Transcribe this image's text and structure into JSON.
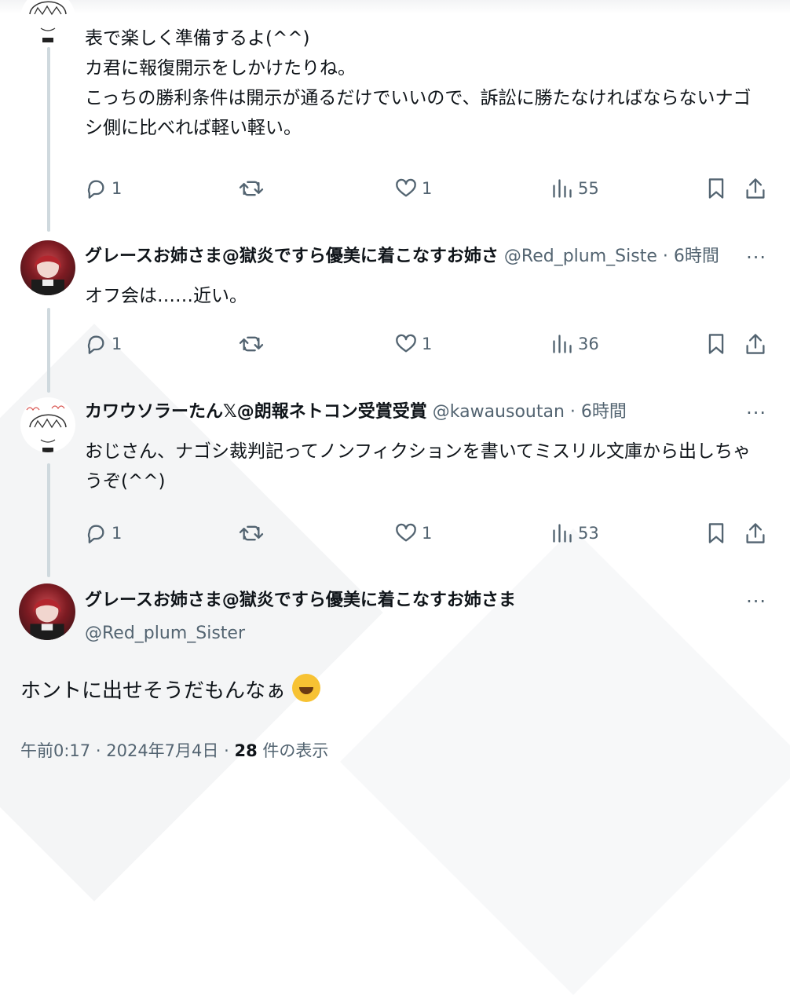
{
  "tweets": [
    {
      "body": [
        "表で楽しく準備するよ(^^)",
        "カ君に報復開示をしかけたりね。",
        "こっちの勝利条件は開示が通るだけでいいので、訴訟に勝たなければならないナゴ",
        "シ側に比べれば軽い軽い。"
      ],
      "reply_count": "1",
      "like_count": "1",
      "view_count": "55"
    },
    {
      "name": "グレースお姉さま@獄炎ですら優美に着こなすお姉さ",
      "handle": "@Red_plum_Siste",
      "time": "· 6時間",
      "body": [
        "オフ会は……近い。"
      ],
      "reply_count": "1",
      "like_count": "1",
      "view_count": "36"
    },
    {
      "name": "カワウソラーたん𝕏@朗報ネトコン受賞受賞",
      "handle": "@kawausoutan",
      "time": "· 6時間",
      "body": [
        "おじさん、ナゴシ裁判記ってノンフィクションを書いてミスリル文庫から出しちゃ",
        "うぞ(^^)"
      ],
      "reply_count": "1",
      "like_count": "1",
      "view_count": "53"
    }
  ],
  "main": {
    "name": "グレースお姉さま@獄炎ですら優美に着こなすお姉さま",
    "handle": "@Red_plum_Sister",
    "body": "ホントに出せそうだもんなぁ",
    "time": "午前0:17",
    "date": "2024年7月4日",
    "views_count": "28",
    "views_label": "件の表示"
  },
  "more_label": "···",
  "icons": [
    "reply-icon",
    "retweet-icon",
    "like-icon",
    "views-icon",
    "bookmark-icon",
    "share-icon",
    "more-icon",
    "rofl-emoji"
  ],
  "colors": {
    "text": "#0f1419",
    "secondary": "#536471",
    "thread_line": "#cfd9de"
  }
}
